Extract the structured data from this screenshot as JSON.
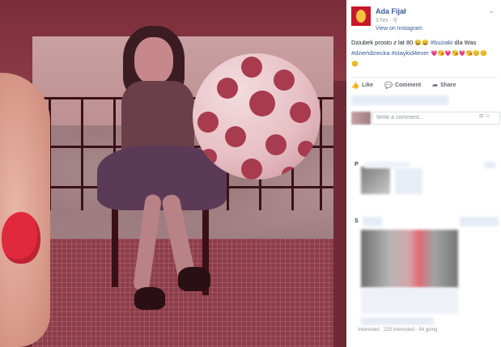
{
  "post": {
    "author": "Ada Fijał",
    "time": "3 hrs",
    "globe": "⚲",
    "view_on": "View on Instagram",
    "text_main": "Dziubek prosto z lat 80",
    "emoji_1": "😄😄",
    "hashtag_1": "#buziaki",
    "text_2": "dla Was",
    "hashtag_2": "#dzieńdziecka",
    "hashtag_3": "#staykid4ever",
    "emoji_2": "💗😘💗😘💗😘😊😊",
    "emoji_3": "😊"
  },
  "actions": {
    "like": "Like",
    "comment": "Comment",
    "share": "Share"
  },
  "comment_box": {
    "placeholder": "Write a comment..."
  },
  "sidebar": {
    "letter_p": "P",
    "letter_s": "S",
    "footer_text": "Interested · 225 interested · 54 going"
  },
  "colors": {
    "link": "#365899",
    "nail": "#e0293d",
    "ball_dots": "#a83b4d"
  }
}
